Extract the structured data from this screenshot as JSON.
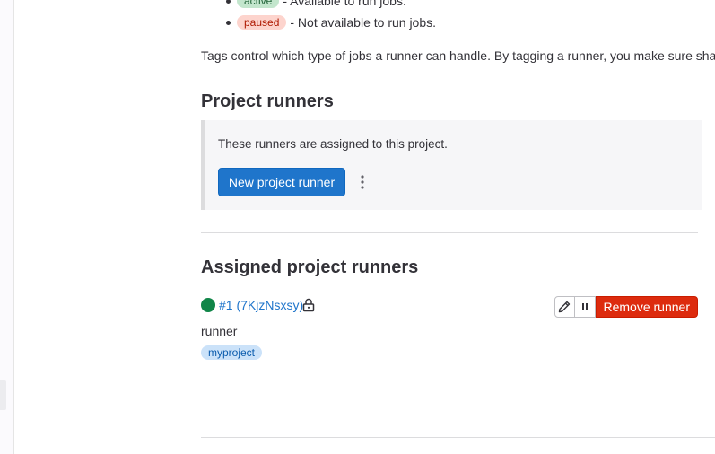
{
  "status_legend": {
    "active": {
      "label": "active",
      "description": "- Available to run jobs."
    },
    "paused": {
      "label": "paused",
      "description": "- Not available to run jobs."
    }
  },
  "tags_text": "Tags control which type of jobs a runner can handle. By tagging a runner, you make sure share",
  "project_runners": {
    "title": "Project runners",
    "info": "These runners are assigned to this project.",
    "new_button": "New project runner"
  },
  "assigned": {
    "title": "Assigned project runners",
    "runner": {
      "id_label": "#1 (7KjzNsxsy)",
      "description": "runner",
      "tag": "myproject",
      "remove_button": "Remove runner",
      "status_color": "#108548"
    }
  },
  "colors": {
    "primary": "#1f75cb",
    "danger": "#dd2b0e",
    "success": "#108548"
  }
}
